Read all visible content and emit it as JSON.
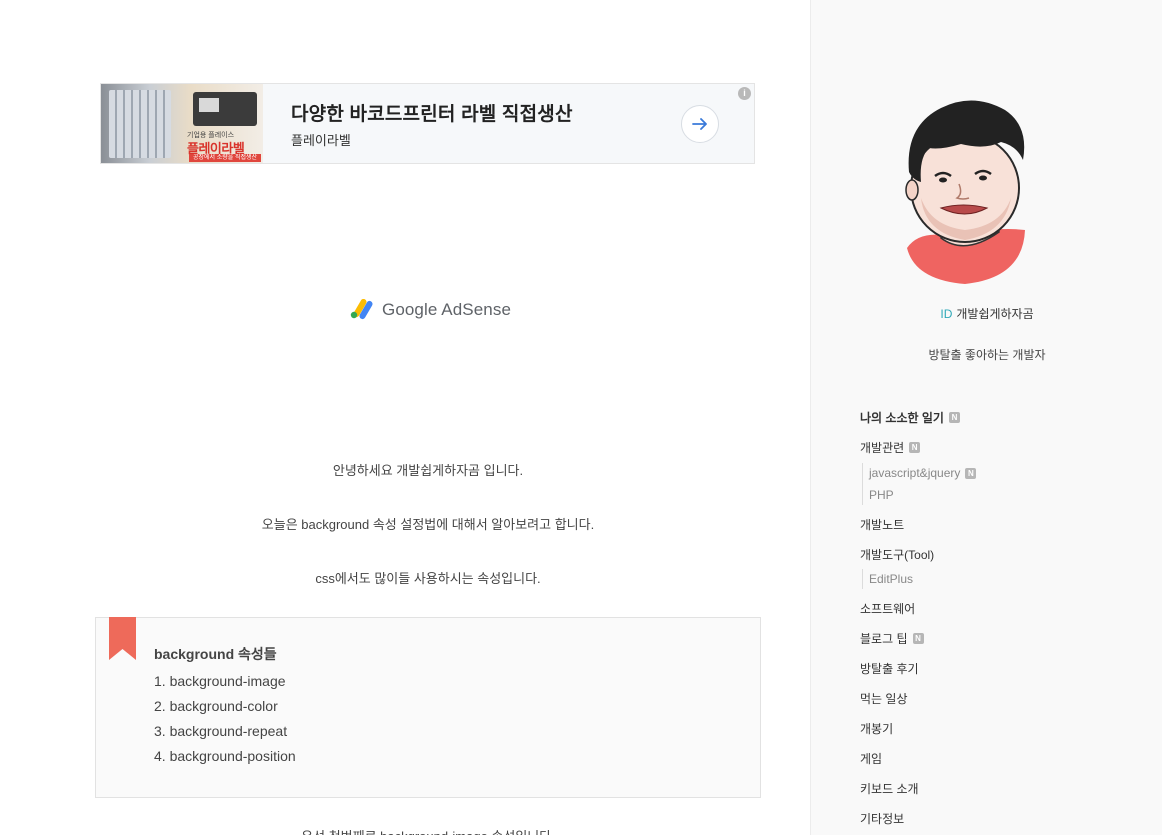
{
  "ad": {
    "title": "다양한 바코드프린터 라벨 직접생산",
    "subtitle": "플레이라벨",
    "brand_small": "기업용 플레이스",
    "brand": "플레이라벨",
    "tagline": "공장에서 소량을 직접생산"
  },
  "adsense": {
    "label": "Google AdSense"
  },
  "post": {
    "greeting": "안녕하세요 개발쉽게하자곰 입니다.",
    "intro": "오늘은 background 속성 설정법에 대해서 알아보려고 합니다.",
    "usage": "css에서도 많이들 사용하시는 속성입니다.",
    "box": {
      "title": "background 속성들",
      "items": [
        "1. background-image",
        "2. background-color",
        "3. background-repeat",
        "4. background-position"
      ]
    },
    "cut_text": "우선 첫번째로 background-image 속성입니다."
  },
  "sidebar": {
    "id_label": "ID",
    "username": "개발쉽게하자곰",
    "description": "방탈출 좋아하는 개발자",
    "badge": "N",
    "categories": {
      "root": "나의 소소한 일기",
      "dev": "개발관련",
      "dev_sub1": "javascript&jquery",
      "dev_sub2": "PHP",
      "note": "개발노트",
      "tool": "개발도구(Tool)",
      "tool_sub1": "EditPlus",
      "software": "소프트웨어",
      "blog_tip": "블로그 팁",
      "escape": "방탈출 후기",
      "eat": "먹는 일상",
      "unboxing": "개봉기",
      "game": "게임",
      "keyboard": "키보드 소개",
      "etc": "기타정보"
    }
  }
}
